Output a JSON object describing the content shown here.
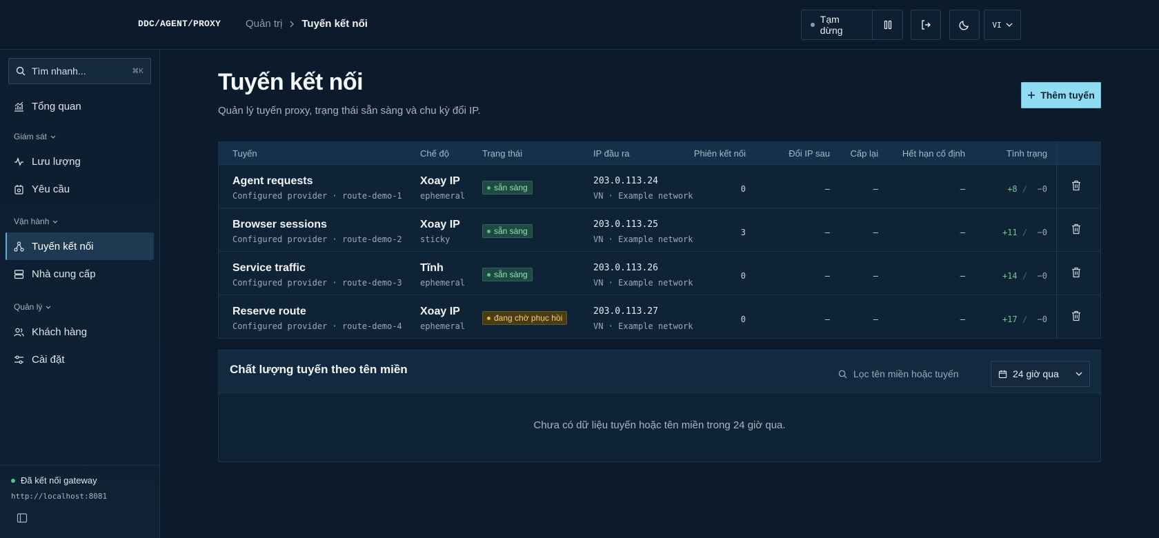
{
  "brand": "DDC/AGENT/PROXY",
  "breadcrumb": {
    "parent": "Quản trị",
    "current": "Tuyến kết nối"
  },
  "topbar": {
    "pause_label": "Tạm dừng",
    "lang": "VI"
  },
  "sidebar": {
    "search_placeholder": "Tìm nhanh...",
    "search_shortcut": "⌘K",
    "overview": "Tổng quan",
    "sections": {
      "monitor": "Giám sát",
      "operate": "Vận hành",
      "manage": "Quản lý"
    },
    "items": {
      "traffic": "Lưu lượng",
      "requests": "Yêu cầu",
      "routes": "Tuyến kết nối",
      "providers": "Nhà cung cấp",
      "customers": "Khách hàng",
      "settings": "Cài đặt"
    },
    "gateway_status": "Đã kết nối gateway",
    "gateway_url": "http://localhost:8081"
  },
  "page": {
    "title": "Tuyến kết nối",
    "subtitle": "Quản lý tuyến proxy, trạng thái sẵn sàng và chu kỳ đổi IP.",
    "add_button": "Thêm tuyến"
  },
  "table": {
    "headers": {
      "route": "Tuyến",
      "mode": "Chế độ",
      "status": "Trạng thái",
      "egress_ip": "IP đầu ra",
      "sessions": "Phiên kết nối",
      "rotate_after": "Đổi IP sau",
      "reissue": "Cấp lại",
      "sticky_expiry": "Hết hạn cố định",
      "health": "Tình trạng"
    },
    "rows": [
      {
        "name": "Agent requests",
        "sub": "Configured provider · route-demo-1",
        "mode": "Xoay IP",
        "mode_sub": "ephemeral",
        "status": "sẵn sàng",
        "status_kind": "ok",
        "ip": "203.0.113.24",
        "ip_sub": "VN · Example network",
        "sessions": "0",
        "rotate": "—",
        "reissue": "—",
        "expiry": "—",
        "health_pos": "+8",
        "health_neg": "−0"
      },
      {
        "name": "Browser sessions",
        "sub": "Configured provider · route-demo-2",
        "mode": "Xoay IP",
        "mode_sub": "sticky",
        "status": "sẵn sàng",
        "status_kind": "ok",
        "ip": "203.0.113.25",
        "ip_sub": "VN · Example network",
        "sessions": "3",
        "rotate": "—",
        "reissue": "—",
        "expiry": "—",
        "health_pos": "+11",
        "health_neg": "−0"
      },
      {
        "name": "Service traffic",
        "sub": "Configured provider · route-demo-3",
        "mode": "Tĩnh",
        "mode_sub": "ephemeral",
        "status": "sẵn sàng",
        "status_kind": "ok",
        "ip": "203.0.113.26",
        "ip_sub": "VN · Example network",
        "sessions": "0",
        "rotate": "—",
        "reissue": "—",
        "expiry": "—",
        "health_pos": "+14",
        "health_neg": "−0"
      },
      {
        "name": "Reserve route",
        "sub": "Configured provider · route-demo-4",
        "mode": "Xoay IP",
        "mode_sub": "ephemeral",
        "status": "đang chờ phục hồi",
        "status_kind": "warn",
        "ip": "203.0.113.27",
        "ip_sub": "VN · Example network",
        "sessions": "0",
        "rotate": "—",
        "reissue": "—",
        "expiry": "—",
        "health_pos": "+17",
        "health_neg": "−0"
      }
    ]
  },
  "quality": {
    "title": "Chất lượng tuyến theo tên miền",
    "filter_placeholder": "Lọc tên miền hoặc tuyến",
    "range": "24 giờ qua",
    "empty": "Chưa có dữ liệu tuyến hoặc tên miền trong 24 giờ qua."
  },
  "colors": {
    "accent": "#8fdcf3",
    "ok": "#4ec38b",
    "warn": "#e5b743",
    "bg": "#0b1b2b"
  }
}
